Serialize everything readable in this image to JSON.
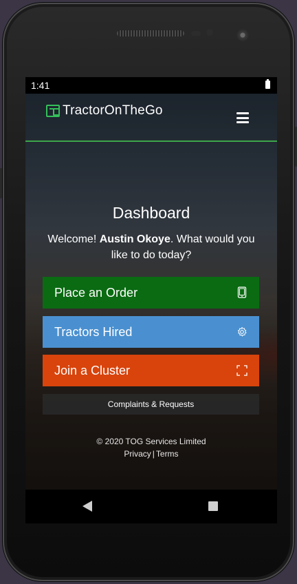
{
  "status_bar": {
    "time": "1:41"
  },
  "header": {
    "logo_text": "TractorOnTheGo",
    "menu_icon": "hamburger-menu-icon"
  },
  "main": {
    "title": "Dashboard",
    "welcome_prefix": "Welcome! ",
    "user_name": "Austin Okoye",
    "welcome_suffix": ". What would you like to do today?"
  },
  "actions": [
    {
      "label": "Place an Order",
      "icon": "tablet-icon",
      "color": "#0a6b12"
    },
    {
      "label": "Tractors Hired",
      "icon": "gear-icon",
      "color": "#4a90d0"
    },
    {
      "label": "Join a Cluster",
      "icon": "expand-icon",
      "color": "#d8440c"
    }
  ],
  "complaints_label": "Complaints & Requests",
  "footer": {
    "copyright": "© 2020 TOG Services Limited",
    "privacy": "Privacy",
    "separator": "|",
    "terms": "Terms"
  },
  "colors": {
    "brand_green": "#34c05a",
    "divider_green": "#3fa64a"
  }
}
